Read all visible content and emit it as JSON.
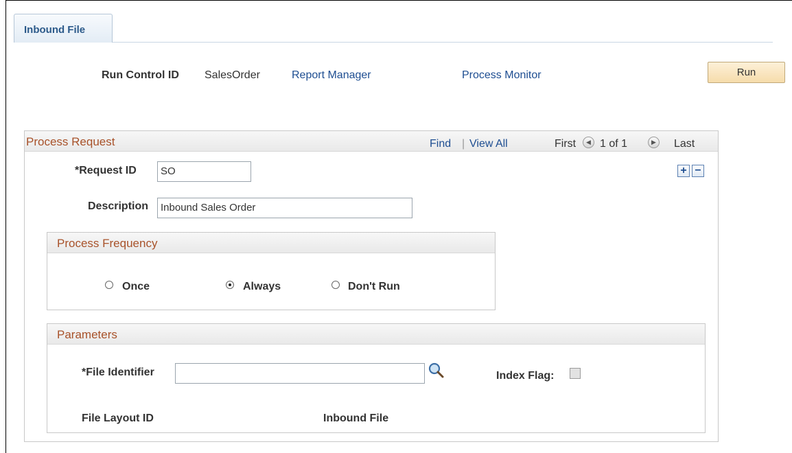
{
  "tab": {
    "label": "Inbound File"
  },
  "header": {
    "run_control_label": "Run Control ID",
    "run_control_value": "SalesOrder",
    "report_manager": "Report Manager",
    "process_monitor": "Process Monitor",
    "run_button": "Run"
  },
  "process_request": {
    "title": "Process Request",
    "find": "Find",
    "separator": "|",
    "view_all": "View All",
    "first": "First",
    "position": "1 of 1",
    "last": "Last",
    "add_row": "+",
    "delete_row": "−",
    "request_id_label": "*Request ID",
    "request_id_value": "SO",
    "description_label": "Description",
    "description_value": "Inbound Sales Order"
  },
  "process_frequency": {
    "title": "Process Frequency",
    "options": [
      {
        "label": "Once",
        "selected": false
      },
      {
        "label": "Always",
        "selected": true
      },
      {
        "label": "Don't Run",
        "selected": false
      }
    ]
  },
  "parameters": {
    "title": "Parameters",
    "file_identifier_label": "*File Identifier",
    "file_identifier_value": "",
    "index_flag_label": "Index Flag:",
    "index_flag_checked": false,
    "file_layout_label": "File Layout ID",
    "inbound_file_label": "Inbound File"
  },
  "icons": {
    "lookup": "search-icon",
    "prev": "prev-arrow-icon",
    "next": "next-arrow-icon"
  }
}
